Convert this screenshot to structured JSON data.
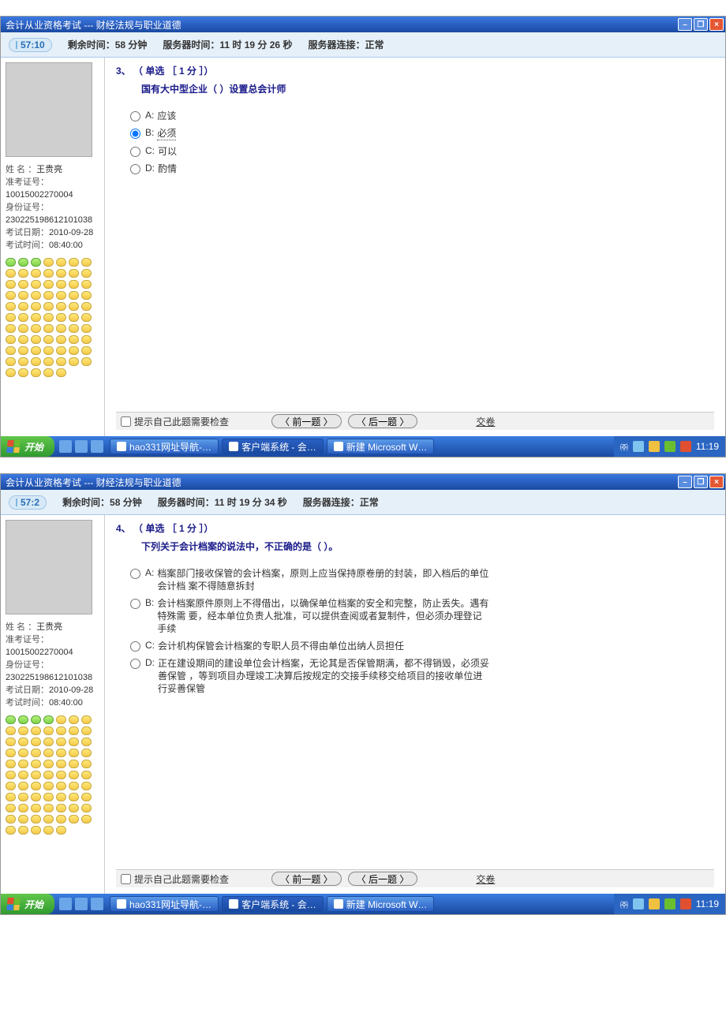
{
  "screens": [
    {
      "title_prefix": "会计从业资格考试 --- ",
      "title_suffix": "财经法规与职业道德",
      "timer_badge": "57:10",
      "remaining": "剩余时间：58 分钟",
      "server_time": "服务器时间：11 时 19 分 26 秒",
      "server_status": "服务器连接：正常",
      "student": {
        "name_label": "姓 名 ：",
        "name": "王贵亮",
        "ticket_label": "准考证号：",
        "ticket": "10015002270004",
        "id_label": "身份证号：",
        "id": "230225198612101038",
        "date_label": "考试日期：",
        "date": "2010-09-28",
        "time_label": "考试时间：",
        "time": "08:40:00"
      },
      "question": {
        "number": "3、",
        "type": "（ 单选 ［ 1 分 ］）",
        "stem": "国有大中型企业（  ）设置总会计师",
        "options": [
          {
            "letter": "A:",
            "text": "应该",
            "selected": false
          },
          {
            "letter": "B:",
            "text": "必须",
            "selected": true,
            "underline": true
          },
          {
            "letter": "C:",
            "text": "可以",
            "selected": false
          },
          {
            "letter": "D:",
            "text": "酌情",
            "selected": false
          }
        ]
      },
      "nav": {
        "first_green": 3
      },
      "footer": {
        "review": "提示自己此题需要检查",
        "prev": "〈 前一题 〉",
        "next": "〈 后一题 〉",
        "submit": "交卷"
      },
      "taskbar": {
        "start": "开始",
        "tabs": [
          "hao331网址导航-…",
          "客户端系统 - 会…",
          "新建 Microsoft W…"
        ],
        "clock": "11:19"
      }
    },
    {
      "title_prefix": "会计从业资格考试 --- ",
      "title_suffix": "财经法规与职业道德",
      "timer_badge": "57:2",
      "remaining": "剩余时间：58 分钟",
      "server_time": "服务器时间：11 时 19 分 34 秒",
      "server_status": "服务器连接：正常",
      "student": {
        "name_label": "姓 名 ：",
        "name": "王贵亮",
        "ticket_label": "准考证号：",
        "ticket": "10015002270004",
        "id_label": "身份证号：",
        "id": "230225198612101038",
        "date_label": "考试日期：",
        "date": "2010-09-28",
        "time_label": "考试时间：",
        "time": "08:40:00"
      },
      "question": {
        "number": "4、",
        "type": "（ 单选 ［ 1 分 ］）",
        "stem": "下列关于会计档案的说法中，不正确的是（  ）。",
        "options": [
          {
            "letter": "A:",
            "text": "档案部门接收保管的会计档案，原则上应当保持原卷册的封装，即入档后的单位会计档 案不得随意拆封",
            "selected": false
          },
          {
            "letter": "B:",
            "text": "会计档案原件原则上不得借出，以确保单位档案的安全和完整，防止丢失。遇有特殊需 要，经本单位负责人批准，可以提供查阅或者复制件，但必须办理登记手续",
            "selected": false
          },
          {
            "letter": "C:",
            "text": "会计机构保管会计档案的专职人员不得由单位出纳人员担任",
            "selected": false
          },
          {
            "letter": "D:",
            "text": "正在建设期间的建设单位会计档案，无论其是否保管期满，都不得销毁，必须妥善保管 ，等到项目办理竣工决算后按规定的交接手续移交给项目的接收单位进行妥善保管",
            "selected": false
          }
        ]
      },
      "nav": {
        "first_green": 4
      },
      "footer": {
        "review": "提示自己此题需要检查",
        "prev": "〈 前一题 〉",
        "next": "〈 后一题 〉",
        "submit": "交卷"
      },
      "taskbar": {
        "start": "开始",
        "tabs": [
          "hao331网址导航-…",
          "客户端系统 - 会…",
          "新建 Microsoft W…"
        ],
        "clock": "11:19"
      }
    }
  ],
  "nav_total": 75
}
